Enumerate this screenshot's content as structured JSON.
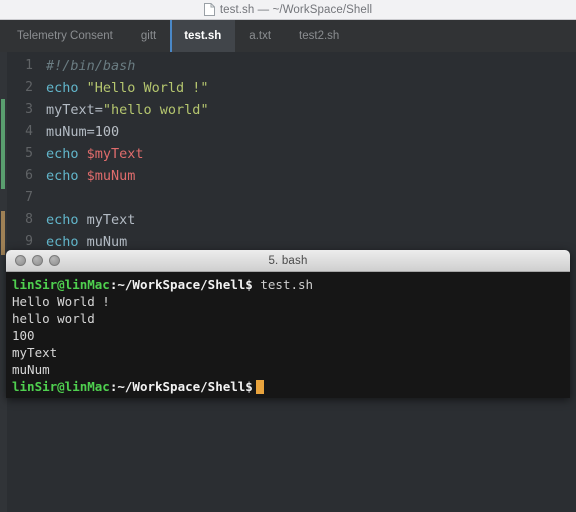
{
  "window": {
    "title": "test.sh — ~/WorkSpace/Shell",
    "doc_icon": "document-icon"
  },
  "tabs": [
    {
      "label": "Telemetry Consent",
      "active": false
    },
    {
      "label": "gitt",
      "active": false
    },
    {
      "label": "test.sh",
      "active": true
    },
    {
      "label": "a.txt",
      "active": false
    },
    {
      "label": "test2.sh",
      "active": false
    }
  ],
  "editor": {
    "accent_active_tab": "#4a88c7",
    "background": "#2b2e32",
    "vcs_marker_added": "#5a9e6f",
    "vcs_marker_modified": "#9e8055",
    "lines": [
      {
        "n": "1",
        "tokens": [
          {
            "text": "#!/bin/bash",
            "cls": "t-comment"
          }
        ]
      },
      {
        "n": "2",
        "tokens": [
          {
            "text": "echo ",
            "cls": "t-cmd"
          },
          {
            "text": "\"Hello World !\"",
            "cls": "t-string"
          }
        ]
      },
      {
        "n": "3",
        "tokens": [
          {
            "text": "myText=",
            "cls": "t-plain"
          },
          {
            "text": "\"hello world\"",
            "cls": "t-string"
          }
        ]
      },
      {
        "n": "4",
        "tokens": [
          {
            "text": "muNum=",
            "cls": "t-plain"
          },
          {
            "text": "100",
            "cls": "t-num"
          }
        ]
      },
      {
        "n": "5",
        "tokens": [
          {
            "text": "echo ",
            "cls": "t-cmd"
          },
          {
            "text": "$myText",
            "cls": "t-var"
          }
        ]
      },
      {
        "n": "6",
        "tokens": [
          {
            "text": "echo ",
            "cls": "t-cmd"
          },
          {
            "text": "$muNum",
            "cls": "t-var"
          }
        ]
      },
      {
        "n": "7",
        "tokens": [
          {
            "text": "",
            "cls": "t-plain"
          }
        ]
      },
      {
        "n": "8",
        "tokens": [
          {
            "text": "echo ",
            "cls": "t-cmd"
          },
          {
            "text": "myText",
            "cls": "t-plain"
          }
        ]
      },
      {
        "n": "9",
        "tokens": [
          {
            "text": "echo ",
            "cls": "t-cmd"
          },
          {
            "text": "muNum",
            "cls": "t-plain"
          }
        ]
      }
    ]
  },
  "terminal": {
    "title": "5. bash",
    "cursor_color": "#e8a33d",
    "prompt_color": "#4fd04f",
    "lights": [
      "close-button",
      "minimize-button",
      "zoom-button"
    ],
    "lines": [
      {
        "type": "prompt",
        "user": "linSir@linMac",
        "path": ":~/WorkSpace/Shell$",
        "command": " test.sh"
      },
      {
        "type": "output",
        "text": "Hello World !"
      },
      {
        "type": "output",
        "text": "hello world"
      },
      {
        "type": "output",
        "text": "100"
      },
      {
        "type": "output",
        "text": "myText"
      },
      {
        "type": "output",
        "text": "muNum"
      },
      {
        "type": "prompt",
        "user": "linSir@linMac",
        "path": ":~/WorkSpace/Shell$",
        "command": "",
        "cursor": true
      }
    ]
  }
}
